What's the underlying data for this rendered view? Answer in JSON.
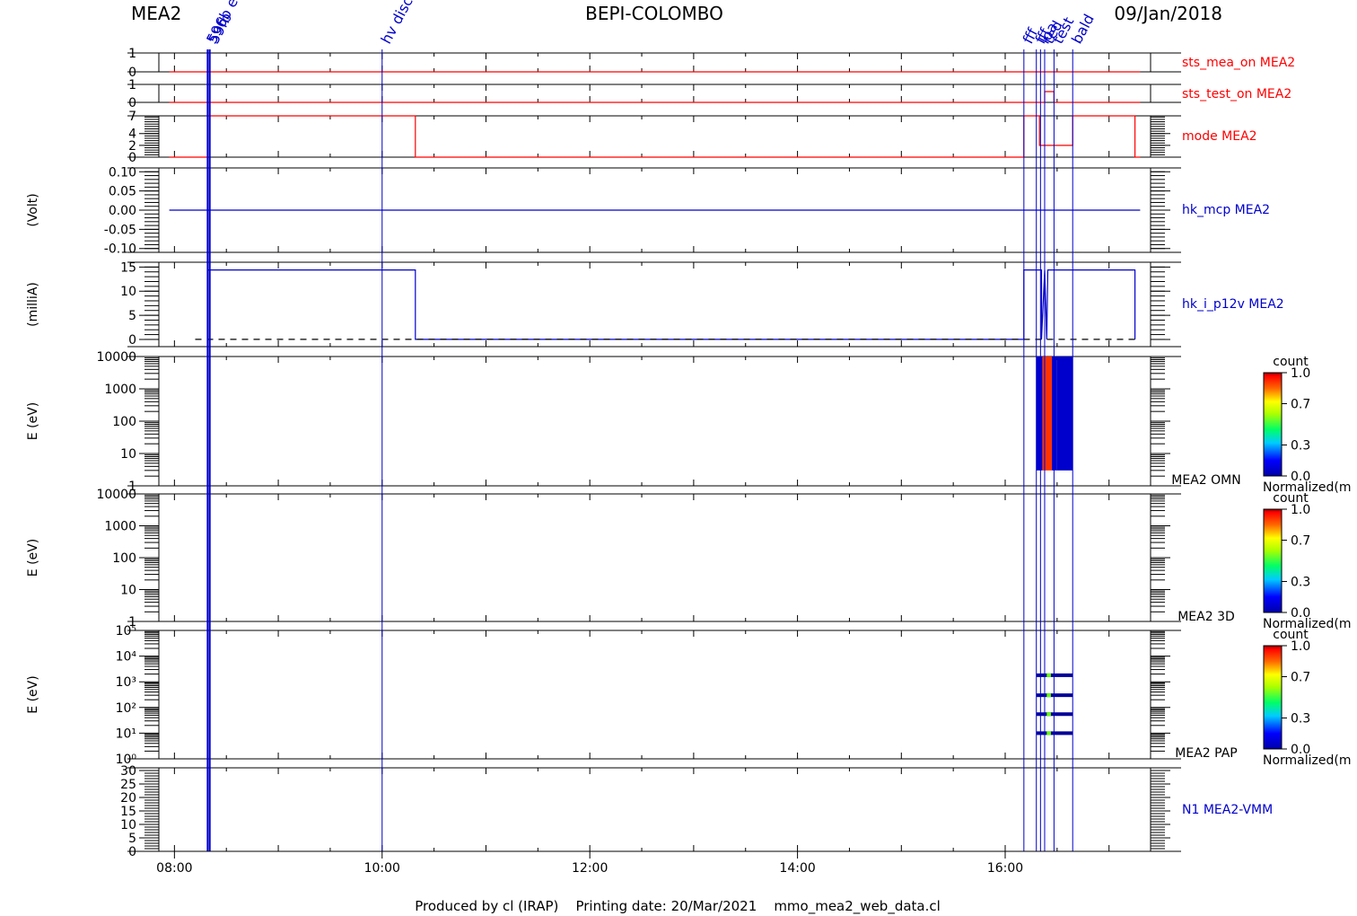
{
  "header": {
    "instrument": "MEA2",
    "mission": "BEPI-COLOMBO",
    "date": "09/Jan/2018"
  },
  "footer": {
    "text": "Produced by cl (IRAP)    Printing date: 20/Mar/2021    mmo_mea2_web_data.cl"
  },
  "colors": {
    "red": "#ff0000",
    "blue": "#0000cc",
    "darkblue": "#000099",
    "orange": "#ff3300",
    "green": "#66ff00"
  },
  "chart_data": {
    "type": "line",
    "x_axis": {
      "unit": "hours",
      "range": [
        7.85,
        17.4
      ],
      "ticks": [
        {
          "value": 8,
          "label": "08:00"
        },
        {
          "value": 10,
          "label": "10:00"
        },
        {
          "value": 12,
          "label": "12:00"
        },
        {
          "value": 14,
          "label": "14:00"
        },
        {
          "value": 16,
          "label": "16:00"
        }
      ]
    },
    "event_markers": [
      {
        "time": 8.32,
        "label": "596b e",
        "color": "#0000cc"
      },
      {
        "time": 8.34,
        "label": "59fb",
        "color": "#0000cc"
      },
      {
        "time": 10.0,
        "label": "hv disc",
        "color": "#0000cc"
      },
      {
        "time": 16.18,
        "label": "fff",
        "color": "#0000cc"
      },
      {
        "time": 16.3,
        "label": "fff",
        "color": "#0000cc"
      },
      {
        "time": 16.34,
        "label": "loa",
        "color": "#0000cc"
      },
      {
        "time": 16.38,
        "label": "ted",
        "color": "#0000cc"
      },
      {
        "time": 16.47,
        "label": "test",
        "color": "#0000cc"
      },
      {
        "time": 16.65,
        "label": "bald",
        "color": "#0000cc"
      }
    ],
    "panels": [
      {
        "name": "sts_mea_on MEA2",
        "ylabel": "",
        "ylim": [
          0,
          1
        ],
        "ticks": [
          "0",
          "1"
        ],
        "tick_values": [
          0,
          1
        ],
        "series": [
          {
            "color": "#ff0000",
            "points": [
              [
                7.95,
                0
              ],
              [
                17.3,
                0
              ]
            ]
          }
        ]
      },
      {
        "name": "sts_test_on MEA2",
        "ylabel": "",
        "ylim": [
          0,
          1
        ],
        "ticks": [
          "0",
          "1"
        ],
        "tick_values": [
          0,
          1
        ],
        "series": [
          {
            "color": "#ff0000",
            "points": [
              [
                7.95,
                0
              ],
              [
                16.38,
                0
              ],
              [
                16.38,
                0.6
              ],
              [
                16.47,
                0.6
              ],
              [
                16.47,
                0
              ],
              [
                17.3,
                0
              ]
            ]
          }
        ]
      },
      {
        "name": "mode MEA2",
        "ylabel": "",
        "ylim": [
          0,
          7
        ],
        "ticks": [
          "0",
          "2",
          "4",
          "7"
        ],
        "tick_values": [
          0,
          2,
          4,
          7
        ],
        "series": [
          {
            "color": "#ff0000",
            "points": [
              [
                7.95,
                0
              ],
              [
                8.32,
                0
              ],
              [
                8.32,
                7
              ],
              [
                10.32,
                7
              ],
              [
                10.32,
                0
              ],
              [
                16.18,
                0
              ],
              [
                16.18,
                7
              ],
              [
                16.33,
                7
              ],
              [
                16.33,
                2
              ],
              [
                16.65,
                2
              ],
              [
                16.65,
                7
              ],
              [
                17.25,
                7
              ],
              [
                17.25,
                0
              ],
              [
                17.3,
                0
              ]
            ]
          }
        ]
      },
      {
        "name": "hk_mcp MEA2",
        "ylabel": "(Volt)",
        "ylim": [
          -0.11,
          0.11
        ],
        "ticks": [
          "-0.10",
          "-0.05",
          "0.00",
          "0.05",
          "0.10"
        ],
        "tick_values": [
          -0.1,
          -0.05,
          0.0,
          0.05,
          0.1
        ],
        "series": [
          {
            "color": "#0000cc",
            "points": [
              [
                7.95,
                0
              ],
              [
                17.3,
                0
              ]
            ]
          }
        ]
      },
      {
        "name": "hk_i_p12v MEA2",
        "ylabel": "(milliA)",
        "ylim": [
          -1.5,
          16
        ],
        "ticks": [
          "0",
          "5",
          "10",
          "15"
        ],
        "tick_values": [
          0,
          5,
          10,
          15
        ],
        "series": [
          {
            "color": "#0000cc",
            "points": [
              [
                8.32,
                14.4
              ],
              [
                10.32,
                14.4
              ],
              [
                10.32,
                0
              ],
              [
                16.18,
                0
              ],
              [
                16.18,
                14.4
              ],
              [
                16.35,
                14.4
              ],
              [
                16.35,
                0
              ],
              [
                16.38,
                14.4
              ],
              [
                16.4,
                0
              ],
              [
                16.41,
                14.4
              ],
              [
                16.65,
                14.4
              ],
              [
                16.65,
                14.4
              ],
              [
                17.25,
                14.4
              ],
              [
                17.25,
                0
              ]
            ]
          },
          {
            "color": "#000000",
            "dashed": true,
            "points": [
              [
                8.2,
                0
              ],
              [
                17.3,
                0
              ]
            ]
          }
        ]
      },
      {
        "name": "MEA2 OMN",
        "ylabel": "E (eV)",
        "log": true,
        "ylim": [
          1,
          10000
        ],
        "ticks": [
          "1",
          "10",
          "100",
          "1000",
          "10000"
        ],
        "tick_values": [
          1,
          10,
          100,
          1000,
          10000
        ],
        "spectrogram": [
          {
            "t0": 16.3,
            "t1": 16.36,
            "color": "#0000cc"
          },
          {
            "t0": 16.36,
            "t1": 16.38,
            "color": "#ff3300"
          },
          {
            "t0": 16.38,
            "t1": 16.45,
            "color": "#ff3300"
          },
          {
            "t0": 16.45,
            "t1": 16.5,
            "color": "#0000cc"
          },
          {
            "t0": 16.5,
            "t1": 16.65,
            "color": "#0000cc"
          }
        ],
        "spec_ylim": [
          3,
          10000
        ],
        "colorbar": {
          "title": "count",
          "ticks": [
            "0.0",
            "0.3",
            "0.7",
            "1.0"
          ],
          "label": "Normalized(m"
        }
      },
      {
        "name": "MEA2 3D",
        "ylabel": "E (eV)",
        "log": true,
        "ylim": [
          1,
          10000
        ],
        "ticks": [
          "1",
          "10",
          "100",
          "1000",
          "10000"
        ],
        "tick_values": [
          1,
          10,
          100,
          1000,
          10000
        ],
        "colorbar": {
          "title": "count",
          "ticks": [
            "0.0",
            "0.3",
            "0.7",
            "1.0"
          ],
          "label": "Normalized(m"
        }
      },
      {
        "name": "MEA2 PAP",
        "ylabel": "E (eV)",
        "log": true,
        "ylim": [
          1,
          100000
        ],
        "ticks": [
          "10⁰",
          "10¹",
          "10²",
          "10³",
          "10⁴",
          "10⁵"
        ],
        "tick_values": [
          1,
          10,
          100,
          1000,
          10000,
          100000
        ],
        "bands": [
          {
            "e": 1800,
            "t0": 16.3,
            "t1": 16.65
          },
          {
            "e": 300,
            "t0": 16.3,
            "t1": 16.65
          },
          {
            "e": 55,
            "t0": 16.3,
            "t1": 16.65
          },
          {
            "e": 10,
            "t0": 16.3,
            "t1": 16.65
          }
        ],
        "colorbar": {
          "title": "count",
          "ticks": [
            "0.0",
            "0.3",
            "0.7",
            "1.0"
          ],
          "label": "Normalized(m"
        }
      },
      {
        "name": "N1 MEA2-VMM",
        "ylabel": "",
        "ylim": [
          0,
          31
        ],
        "ticks": [
          "0",
          "5",
          "10",
          "15",
          "20",
          "25",
          "30"
        ],
        "tick_values": [
          0,
          5,
          10,
          15,
          20,
          25,
          30
        ]
      }
    ]
  }
}
